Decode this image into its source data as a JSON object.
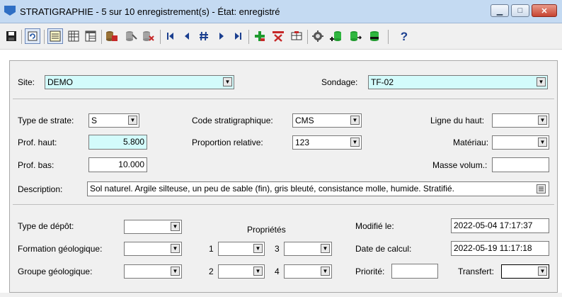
{
  "window": {
    "title": "STRATIGRAPHIE - 5 sur 10 enregistrement(s) - État: enregistré",
    "controls": {
      "minimize": "▁",
      "maximize": "□",
      "close": "✕"
    }
  },
  "toolbar": {
    "icons": [
      "save-icon",
      "refresh-icon",
      "form-view-icon",
      "table-view-icon",
      "list-view-icon",
      "db-link-icon",
      "db-tools-icon",
      "db-delete-icon",
      "first-record-icon",
      "previous-record-icon",
      "goto-record-icon",
      "next-record-icon",
      "last-record-icon",
      "add-record-icon",
      "delete-record-icon",
      "copy-record-icon",
      "settings-icon",
      "db-add-icon",
      "db-export-icon",
      "db-import-icon",
      "help-icon"
    ],
    "help_label": "?"
  },
  "form": {
    "site": {
      "label": "Site:",
      "value": "DEMO"
    },
    "sondage": {
      "label": "Sondage:",
      "value": "TF-02"
    },
    "type_strate": {
      "label": "Type de strate:",
      "value": "S"
    },
    "code_strat": {
      "label": "Code stratigraphique:",
      "value": "CMS"
    },
    "ligne_haut": {
      "label": "Ligne du haut:",
      "value": ""
    },
    "prof_haut": {
      "label": "Prof. haut:",
      "value": "5.800"
    },
    "proportion": {
      "label": "Proportion relative:",
      "value": "123"
    },
    "materiau": {
      "label": "Matériau:",
      "value": ""
    },
    "prof_bas": {
      "label": "Prof. bas:",
      "value": "10.000"
    },
    "masse_volum": {
      "label": "Masse volum.:",
      "value": ""
    },
    "description": {
      "label": "Description:",
      "value": "Sol naturel. Argile silteuse, un peu de sable (fin), gris bleuté, consistance molle, humide. Stratifié."
    },
    "type_depot": {
      "label": "Type de dépôt:",
      "value": ""
    },
    "proprietes": {
      "label": "Propriétés",
      "p1": "1",
      "p2": "2",
      "p3": "3",
      "p4": "4"
    },
    "modifie_le": {
      "label": "Modifié le:",
      "value": "2022-05-04 17:17:37"
    },
    "formation": {
      "label": "Formation géologique:",
      "value": ""
    },
    "date_calcul": {
      "label": "Date de calcul:",
      "value": "2022-05-19 11:17:18"
    },
    "groupe": {
      "label": "Groupe géologique:",
      "value": ""
    },
    "priorite": {
      "label": "Priorité:",
      "value": ""
    },
    "transfert": {
      "label": "Transfert:",
      "value": ""
    }
  }
}
